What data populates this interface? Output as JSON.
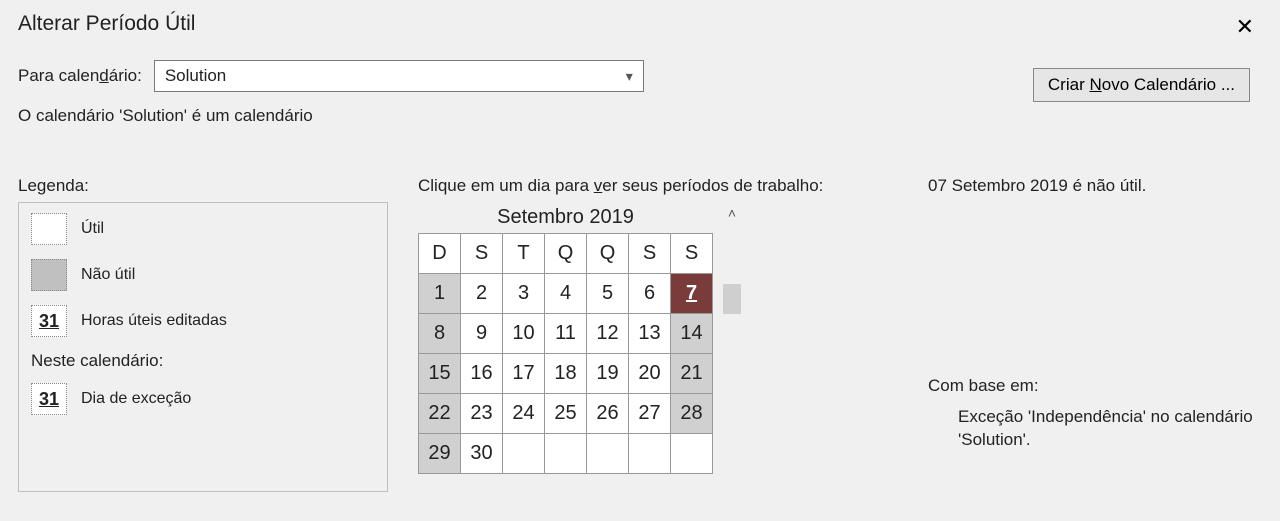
{
  "dialog": {
    "title": "Alterar Período Útil",
    "close": "✕"
  },
  "for_calendar": {
    "label_pre": "Para calen",
    "label_hotkey": "d",
    "label_post": "ário:",
    "value": "Solution"
  },
  "create_button": {
    "label_pre": "Criar ",
    "label_hotkey": "N",
    "label_post": "ovo Calendário ..."
  },
  "description": "O calendário 'Solution' é um calendário",
  "legend": {
    "title": "Legenda:",
    "util": "Útil",
    "nonutil": "Não útil",
    "edited": "Horas úteis editadas",
    "edited_num": "31",
    "sub": "Neste calendário:",
    "exception": "Dia de exceção",
    "exception_num": "31"
  },
  "calendar": {
    "instruction_pre": "Clique em um dia para ",
    "instruction_hotkey": "v",
    "instruction_post": "er seus períodos de trabalho:",
    "month": "Setembro 2019",
    "weekdays": [
      "D",
      "S",
      "T",
      "Q",
      "Q",
      "S",
      "S"
    ],
    "weeks": [
      [
        {
          "d": "1",
          "t": "nonwork"
        },
        {
          "d": "2",
          "t": "work"
        },
        {
          "d": "3",
          "t": "work"
        },
        {
          "d": "4",
          "t": "work"
        },
        {
          "d": "5",
          "t": "work"
        },
        {
          "d": "6",
          "t": "work"
        },
        {
          "d": "7",
          "t": "selected"
        }
      ],
      [
        {
          "d": "8",
          "t": "nonwork"
        },
        {
          "d": "9",
          "t": "work"
        },
        {
          "d": "10",
          "t": "work"
        },
        {
          "d": "11",
          "t": "work"
        },
        {
          "d": "12",
          "t": "work"
        },
        {
          "d": "13",
          "t": "work"
        },
        {
          "d": "14",
          "t": "nonwork"
        }
      ],
      [
        {
          "d": "15",
          "t": "nonwork"
        },
        {
          "d": "16",
          "t": "work"
        },
        {
          "d": "17",
          "t": "work"
        },
        {
          "d": "18",
          "t": "work"
        },
        {
          "d": "19",
          "t": "work"
        },
        {
          "d": "20",
          "t": "work"
        },
        {
          "d": "21",
          "t": "nonwork"
        }
      ],
      [
        {
          "d": "22",
          "t": "nonwork"
        },
        {
          "d": "23",
          "t": "work"
        },
        {
          "d": "24",
          "t": "work"
        },
        {
          "d": "25",
          "t": "work"
        },
        {
          "d": "26",
          "t": "work"
        },
        {
          "d": "27",
          "t": "work"
        },
        {
          "d": "28",
          "t": "nonwork"
        }
      ],
      [
        {
          "d": "29",
          "t": "nonwork"
        },
        {
          "d": "30",
          "t": "work"
        },
        {
          "d": "",
          "t": "empty"
        },
        {
          "d": "",
          "t": "empty"
        },
        {
          "d": "",
          "t": "empty"
        },
        {
          "d": "",
          "t": "empty"
        },
        {
          "d": "",
          "t": "empty"
        }
      ]
    ]
  },
  "info": {
    "day_status": "07 Setembro 2019 é não útil.",
    "based_on": "Com base em:",
    "based_on_detail": "Exceção 'Independência' no calendário 'Solution'."
  }
}
